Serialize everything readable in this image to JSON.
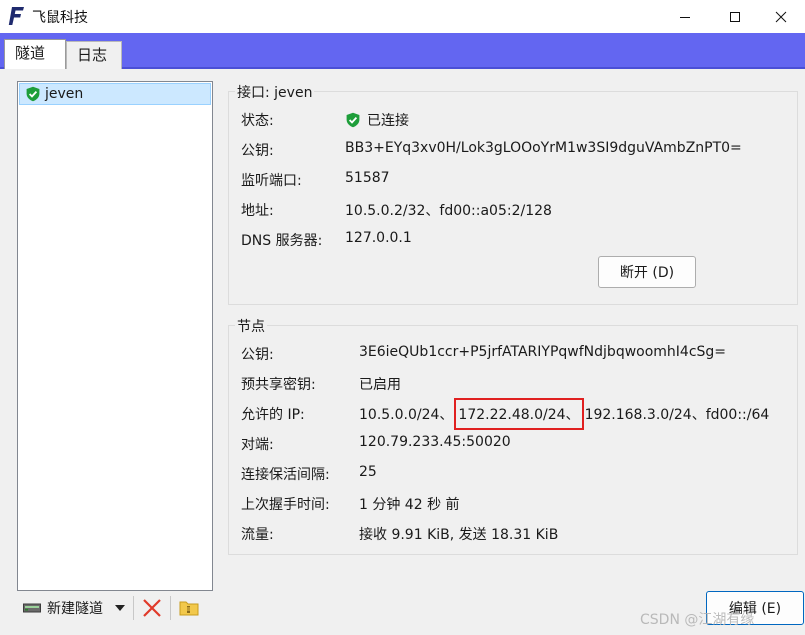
{
  "window": {
    "title": "飞鼠科技",
    "logo_letter": "F"
  },
  "tabs": [
    {
      "label": "隧道"
    },
    {
      "label": "日志"
    }
  ],
  "tunnels": [
    {
      "name": "jeven",
      "status_icon": "shield-check-icon"
    }
  ],
  "toolbar": {
    "new_tunnel_label": "新建隧道"
  },
  "interface": {
    "title": "接口: jeven",
    "status_label": "状态:",
    "status_value": "已连接",
    "public_key_label": "公钥:",
    "public_key": "BB3+EYq3xv0H/Lok3gLOOoYrM1w3SI9dguVAmbZnPT0=",
    "listen_port_label": "监听端口:",
    "listen_port": "51587",
    "address_label": "地址:",
    "address": "10.5.0.2/32、fd00::a05:2/128",
    "dns_label": "DNS 服务器:",
    "dns": "127.0.0.1",
    "disconnect_button": "断开 (D)"
  },
  "peer": {
    "title": "节点",
    "public_key_label": "公钥:",
    "public_key": "3E6ieQUb1ccr+P5jrfATARIYPqwfNdjbqwoomhI4cSg=",
    "preshared_key_label": "预共享密钥:",
    "preshared_key": "已启用",
    "allowed_ips_label": "允许的 IP:",
    "allowed_ips_before": "10.5.0.0/24、",
    "allowed_ips_highlight": "172.22.48.0/24、",
    "allowed_ips_after": "192.168.3.0/24、fd00::/64",
    "endpoint_label": "对端:",
    "endpoint": "120.79.233.45:50020",
    "keepalive_label": "连接保活间隔:",
    "keepalive": "25",
    "handshake_label": "上次握手时间:",
    "handshake": "1 分钟 42 秒 前",
    "transfer_label": "流量:",
    "transfer": "接收 9.91 KiB, 发送 18.31 KiB"
  },
  "edit_button": "编辑 (E)",
  "watermark": "CSDN @江湖有缘",
  "colors": {
    "accent_tabstrip": "#6366f1",
    "shield_green": "#1e9e3a",
    "highlight_red": "#e02020",
    "selection_blue": "#cce8ff"
  }
}
